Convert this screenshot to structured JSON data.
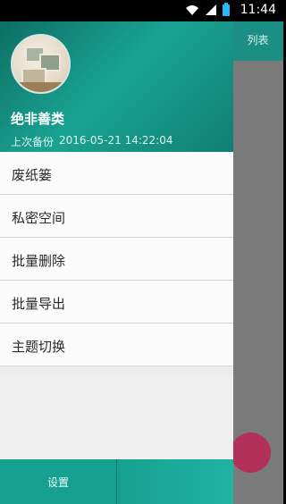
{
  "status_bar": {
    "time": "11:44",
    "icons": [
      "wifi-icon",
      "signal-icon",
      "battery-icon"
    ]
  },
  "app": {
    "toolbar_label": "列表",
    "fab_color": "#b3305b"
  },
  "drawer": {
    "header": {
      "user_name": "绝非善类",
      "backup_label": "上次备份",
      "backup_time": "2016-05-21 14:22:04"
    },
    "menu": [
      {
        "label": "废纸篓"
      },
      {
        "label": "私密空间"
      },
      {
        "label": "批量删除"
      },
      {
        "label": "批量导出"
      },
      {
        "label": "主题切换"
      }
    ],
    "bottom": {
      "settings_label": "设置"
    }
  },
  "colors": {
    "accent": "#16a090",
    "header_dark": "#0d6e64"
  }
}
